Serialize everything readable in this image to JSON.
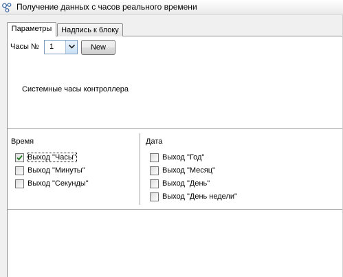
{
  "window": {
    "title": "Получение данных с часов реального времени",
    "icon": "link-nodes-icon"
  },
  "tabs": [
    {
      "label": "Параметры",
      "active": true
    },
    {
      "label": "Надпись к блоку",
      "active": false
    }
  ],
  "clock": {
    "label": "Часы №",
    "selected": "1",
    "new_button": "New",
    "description": "Системные часы контроллера"
  },
  "time_group": {
    "title": "Время",
    "items": [
      {
        "label": "Выход \"Часы\"",
        "checked": true
      },
      {
        "label": "Выход \"Минуты\"",
        "checked": false
      },
      {
        "label": "Выход \"Секунды\"",
        "checked": false
      }
    ]
  },
  "date_group": {
    "title": "Дата",
    "items": [
      {
        "label": "Выход \"Год\"",
        "checked": false
      },
      {
        "label": "Выход \"Месяц\"",
        "checked": false
      },
      {
        "label": "Выход \"День\"",
        "checked": false
      },
      {
        "label": "Выход \"День недели\"",
        "checked": false
      }
    ]
  },
  "colors": {
    "check": "#1e7a1e",
    "panel": "#ffffff",
    "chrome": "#f0f0f0"
  }
}
